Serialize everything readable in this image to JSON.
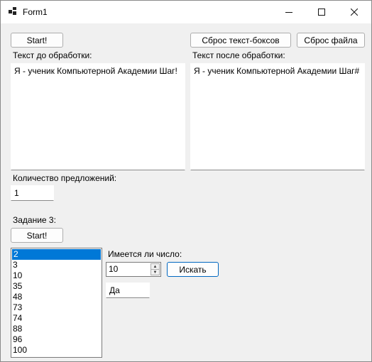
{
  "window": {
    "title": "Form1"
  },
  "task1": {
    "start_label": "Start!",
    "reset_textboxes_label": "Сброс текст-боксов",
    "reset_file_label": "Сброс файла",
    "before_label": "Текст до обработки:",
    "before_text": "Я - ученик Компьютерной Академии Шаг!",
    "after_label": "Текст после обработки:",
    "after_text": "Я - ученик Компьютерной Академии Шаг#",
    "sentence_count_label": "Количество предложений:",
    "sentence_count_value": "1"
  },
  "task3": {
    "title": "Задание 3:",
    "start_label": "Start!",
    "list_items": [
      "2",
      "3",
      "10",
      "35",
      "48",
      "73",
      "74",
      "88",
      "96",
      "100"
    ],
    "selected_item": "2",
    "has_number_label": "Имеется ли число:",
    "number_value": "10",
    "search_label": "Искать",
    "result_value": "Да"
  }
}
